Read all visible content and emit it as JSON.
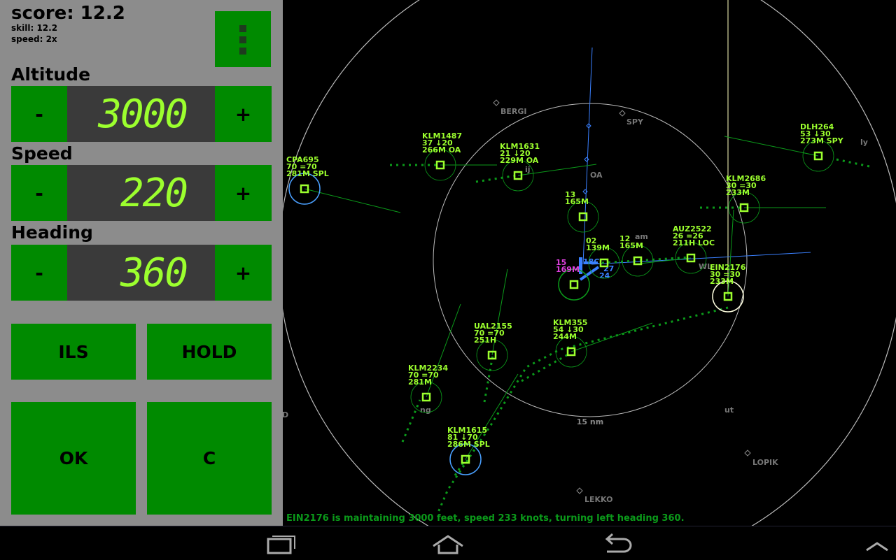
{
  "panel": {
    "score": "score: 12.2",
    "skill": "skill: 12.2",
    "speed_factor": "speed: 2x",
    "altitude": {
      "label": "Altitude",
      "minus": "-",
      "plus": "+",
      "value": "3000"
    },
    "speed": {
      "label": "Speed",
      "minus": "-",
      "plus": "+",
      "value": "220"
    },
    "heading": {
      "label": "Heading",
      "minus": "-",
      "plus": "+",
      "value": "360"
    },
    "ils": "ILS",
    "hold": "HOLD",
    "ok": "OK",
    "clear": "C"
  },
  "colors": {
    "panel": "#8c8c8c",
    "button": "#008a00",
    "display_bg": "#3a3a3a",
    "display_text": "#9cff2e",
    "aircraft": "#9cff2e",
    "selected_ring": "#4aa0ff",
    "highlight_ring": "#ffffe0",
    "trail": "#0b9a1a",
    "runway": "#3a80ff",
    "magenta": "#e040e0",
    "status": "#0b9a1a"
  },
  "status_message": "EIN2176 is maintaining 3000 feet, speed 233 knots, turning left heading 360.",
  "scale_label": "15 nm",
  "waypoints": [
    "BERGI",
    "SPY",
    "OA",
    "am",
    "WL",
    "ut",
    "LOPIK",
    "LEKKO",
    "ly",
    "ij",
    "ng",
    "D"
  ],
  "aircraft": [
    {
      "callsign": "CPA695",
      "line2": "70 =70",
      "line3": "281M SPL"
    },
    {
      "callsign": "KLM1487",
      "line2": "37 ↓20",
      "line3": "266M OA"
    },
    {
      "callsign": "KLM1631",
      "line2": "21 ↓20",
      "line3": "229M OA"
    },
    {
      "callsign": "13",
      "line2": "165M",
      "line3": ""
    },
    {
      "callsign": "DLH264",
      "line2": "53 ↓30",
      "line3": "273M SPY"
    },
    {
      "callsign": "KLM2686",
      "line2": "30 =30",
      "line3": "233M"
    },
    {
      "callsign": "AUZ2522",
      "line2": "26 =26",
      "line3": "211H LOC"
    },
    {
      "callsign": "12",
      "line2": "165M",
      "line3": ""
    },
    {
      "callsign": "02",
      "line2": "139M",
      "line3": ""
    },
    {
      "callsign": "15",
      "line2": "169M",
      "line3": ""
    },
    {
      "callsign": "EIN2176",
      "line2": "30 =30",
      "line3": "233M"
    },
    {
      "callsign": "UAL2155",
      "line2": "70 =70",
      "line3": "251H"
    },
    {
      "callsign": "KLM355",
      "line2": "54 ↓30",
      "line3": "244M"
    },
    {
      "callsign": "KLM2234",
      "line2": "70 =70",
      "line3": "281M"
    },
    {
      "callsign": "KLM1615",
      "line2": "81 ↓70",
      "line3": "286M SPL"
    }
  ],
  "runway_labels": [
    "18C",
    "27",
    "24"
  ],
  "nav": [
    "recent-apps-icon",
    "home-icon",
    "back-icon",
    "up-chevron-icon"
  ]
}
